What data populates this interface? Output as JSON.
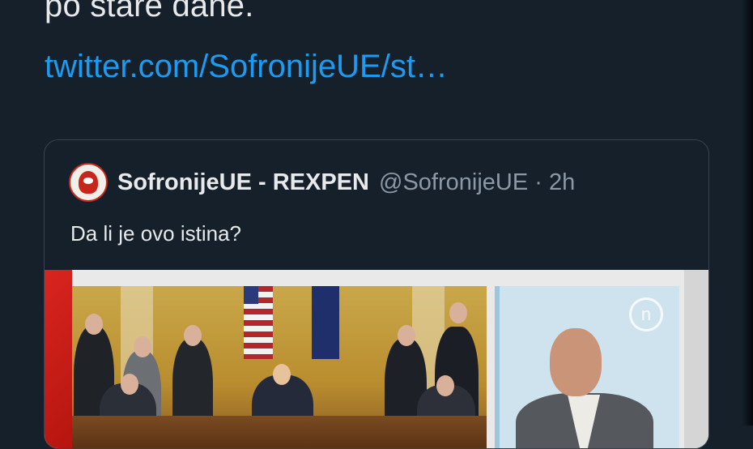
{
  "tweet": {
    "text_tail": "po stare dane.",
    "link_text": "twitter.com/SofronijeUE/st…"
  },
  "quote": {
    "display_name": "SofronijeUE - REXPEN",
    "handle_time": "@SofronijeUE · 2h",
    "text": "Da li je ovo istina?"
  },
  "media": {
    "tv_logo": "n"
  },
  "colors": {
    "background": "#15202b",
    "link": "#1d9bf0",
    "secondary_text": "#8b98a5"
  }
}
